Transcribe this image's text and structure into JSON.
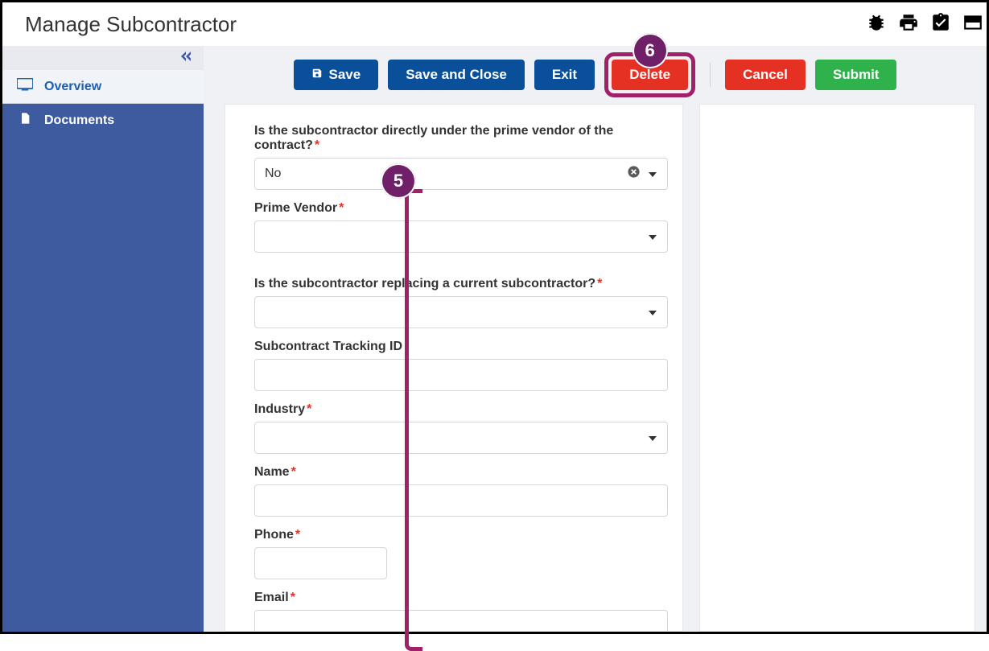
{
  "header": {
    "title": "Manage Subcontractor"
  },
  "callouts": {
    "five": "5",
    "six": "6"
  },
  "sidebar": {
    "items": [
      {
        "label": "Overview"
      },
      {
        "label": "Documents"
      }
    ]
  },
  "toolbar": {
    "save": "Save",
    "saveClose": "Save and Close",
    "exit": "Exit",
    "delete": "Delete",
    "cancel": "Cancel",
    "submit": "Submit"
  },
  "form": {
    "q_underPrime": {
      "label": "Is the subcontractor directly under the prime vendor of the contract?",
      "value": "No"
    },
    "primeVendor": {
      "label": "Prime Vendor",
      "value": ""
    },
    "q_replacing": {
      "label": "Is the subcontractor replacing a current subcontractor?",
      "value": ""
    },
    "trackingId": {
      "label": "Subcontract Tracking ID",
      "value": ""
    },
    "industry": {
      "label": "Industry",
      "value": ""
    },
    "name": {
      "label": "Name",
      "value": ""
    },
    "phone": {
      "label": "Phone",
      "value": ""
    },
    "email": {
      "label": "Email",
      "value": ""
    }
  }
}
